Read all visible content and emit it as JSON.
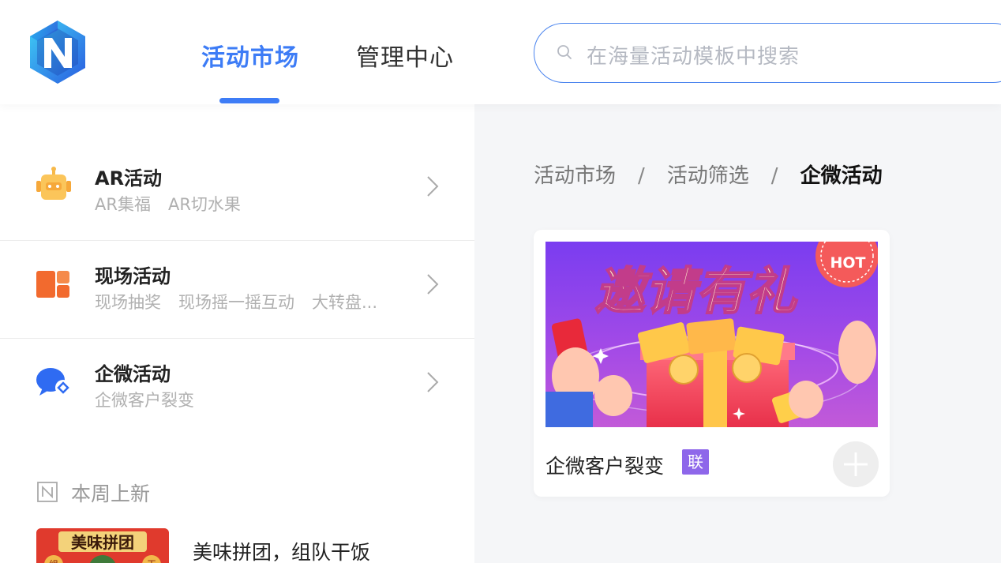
{
  "header": {
    "tabs": [
      {
        "label": "活动市场",
        "active": true
      },
      {
        "label": "管理中心",
        "active": false
      }
    ],
    "search": {
      "placeholder": "在海量活动模板中搜索"
    }
  },
  "sidebar": {
    "categories": [
      {
        "title": "AR活动",
        "subs": [
          "AR集福",
          "AR切水果"
        ],
        "icon": "robot-icon"
      },
      {
        "title": "现场活动",
        "subs": [
          "现场抽奖",
          "现场摇一摇互动",
          "大转盘..."
        ],
        "icon": "book-icon"
      },
      {
        "title": "企微活动",
        "subs": [
          "企微客户裂变"
        ],
        "icon": "chat-icon"
      }
    ],
    "new_this_week": {
      "label": "本周上新",
      "items": [
        {
          "title": "美味拼团，组队干饭",
          "thumb_text": "美味拼团",
          "thumb_chars": [
            "组",
            "干"
          ]
        }
      ]
    }
  },
  "main": {
    "breadcrumb": [
      "活动市场",
      "活动筛选",
      "企微活动"
    ],
    "breadcrumb_sep": "/",
    "card": {
      "title": "企微客户裂变",
      "badge": "联",
      "image_text": "邀请有礼",
      "hot_label": "HOT"
    }
  },
  "colors": {
    "accent": "#3d7cf6",
    "badge": "#8e67ea",
    "panel_bg": "#f5f6f8"
  }
}
